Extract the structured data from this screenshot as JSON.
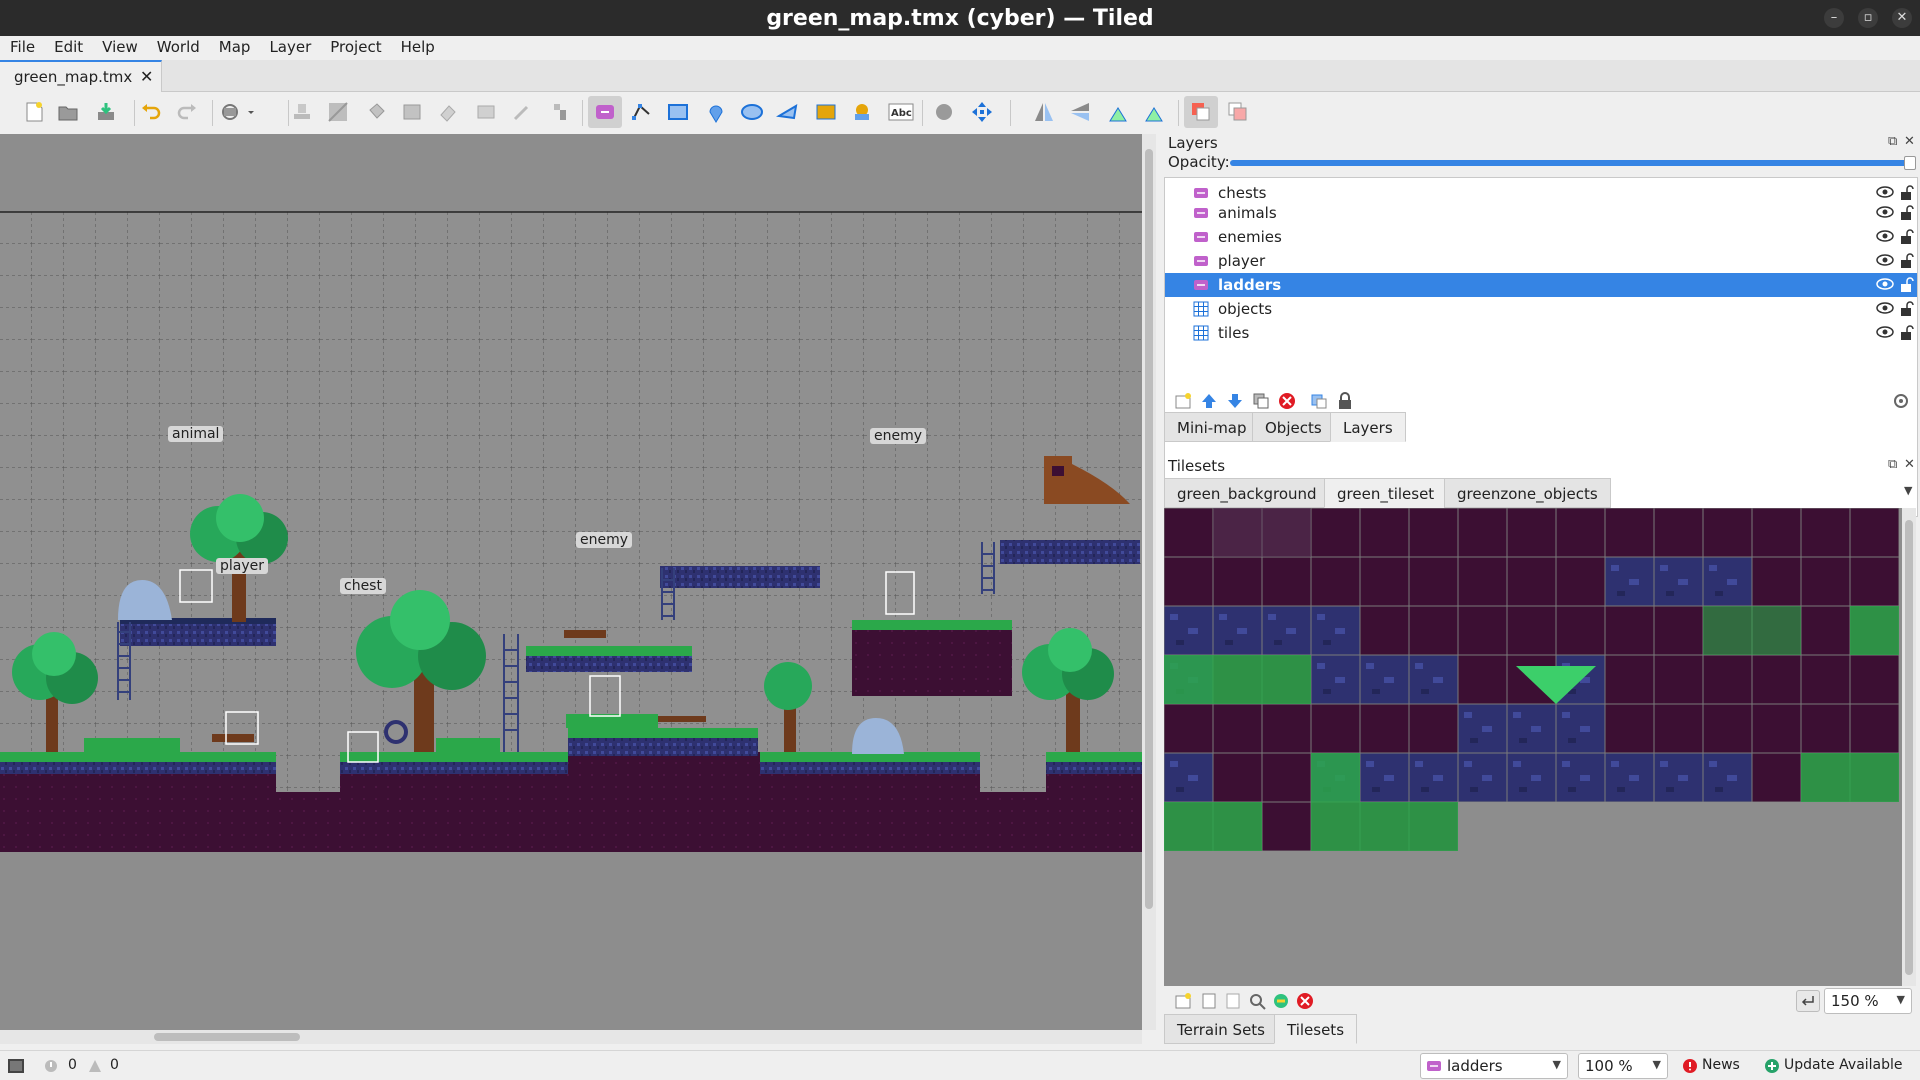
{
  "window": {
    "title": "green_map.tmx (cyber) — Tiled"
  },
  "menu": [
    "File",
    "Edit",
    "View",
    "World",
    "Map",
    "Layer",
    "Project",
    "Help"
  ],
  "document_tab": {
    "label": "green_map.tmx",
    "close": "✕"
  },
  "map": {
    "object_labels": {
      "animal": "animal",
      "enemy_high": "enemy",
      "enemy_mid": "enemy",
      "player": "player",
      "chest": "chest"
    }
  },
  "layers_panel": {
    "title": "Layers",
    "opacity_label": "Opacity:",
    "opacity_value": 1.0,
    "layers": [
      {
        "name": "chests",
        "type": "object"
      },
      {
        "name": "animals",
        "type": "object"
      },
      {
        "name": "enemies",
        "type": "object"
      },
      {
        "name": "player",
        "type": "object"
      },
      {
        "name": "ladders",
        "type": "object",
        "selected": true
      },
      {
        "name": "objects",
        "type": "tile"
      },
      {
        "name": "tiles",
        "type": "tile"
      }
    ],
    "tabs": [
      "Mini-map",
      "Objects",
      "Layers"
    ],
    "active_tab": "Layers"
  },
  "tilesets_panel": {
    "title": "Tilesets",
    "tabs": [
      "green_background",
      "green_tileset",
      "greenzone_objects"
    ],
    "active_tab": "green_tileset",
    "zoom": "150 %",
    "bottom_tabs": [
      "Terrain Sets",
      "Tilesets"
    ],
    "active_bottom_tab": "Tilesets"
  },
  "statusbar": {
    "errors": "0",
    "warnings": "0",
    "current_layer": "ladders",
    "zoom": "100 %",
    "news": "News",
    "update": "Update Available"
  },
  "colors": {
    "accent": "#3584e4",
    "canvas_bg": "#8d8d8d",
    "dirt": "#3c0f33",
    "grass": "#2ba84a",
    "leaves": "#27a85a",
    "trunk": "#6e3a1c",
    "stone": "#2e3170",
    "news_red": "#e01b24",
    "update_green": "#26a269"
  }
}
